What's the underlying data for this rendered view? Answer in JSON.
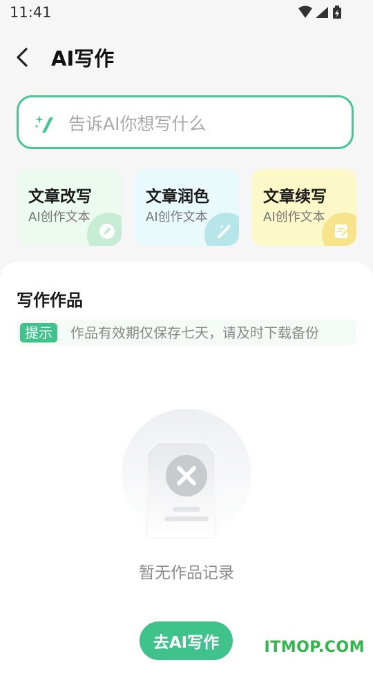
{
  "status_bar": {
    "time": "11:41",
    "icons": [
      "wifi-icon",
      "signal-icon",
      "battery-charging-icon"
    ]
  },
  "header": {
    "back_icon": "chevron-left-icon",
    "title": "AI写作"
  },
  "prompt": {
    "icon": "sparkle-pen-icon",
    "placeholder": "告诉AI你想写什么",
    "value": ""
  },
  "tools": [
    {
      "title": "文章改写",
      "subtitle": "AI创作文本",
      "icon": "pen-icon",
      "bg": "#ecfaf0",
      "icon_bg": "#c7ecd5"
    },
    {
      "title": "文章润色",
      "subtitle": "AI创作文本",
      "icon": "magic-wand-icon",
      "bg": "#e8fafb",
      "icon_bg": "#b7e6ea"
    },
    {
      "title": "文章续写",
      "subtitle": "AI创作文本",
      "icon": "note-edit-icon",
      "bg": "#fcf8c8",
      "icon_bg": "#f7e48a"
    }
  ],
  "works": {
    "title": "写作作品",
    "tip_badge": "提示",
    "tip_text": "作品有效期仅保存七天，请及时下载备份",
    "empty_icon": "empty-document-icon",
    "empty_text": "暂无作品记录",
    "cta_label": "去AI写作"
  },
  "watermark": "ITMOP.COM",
  "colors": {
    "accent": "#3fc28b",
    "border": "#45c693",
    "background": "#f6f6f6"
  }
}
